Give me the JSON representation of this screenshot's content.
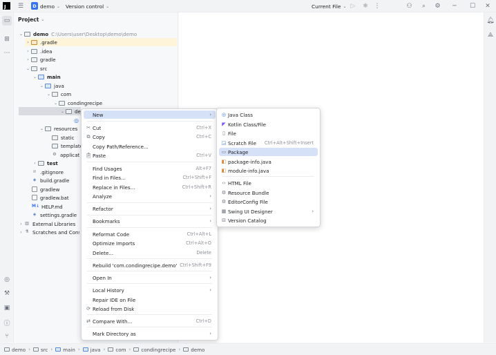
{
  "titlebar": {
    "project_badge": "D",
    "project_name": "demo",
    "vcs_label": "Version control",
    "run_config": "Current File"
  },
  "panel": {
    "title": "Project"
  },
  "tree": [
    {
      "label": "demo",
      "path": "C:\\Users\\user\\Desktop\\demo\\demo"
    },
    {
      "label": ".gradle"
    },
    {
      "label": ".idea"
    },
    {
      "label": "gradle"
    },
    {
      "label": "src"
    },
    {
      "label": "main"
    },
    {
      "label": "java"
    },
    {
      "label": "com"
    },
    {
      "label": "condingrecipe"
    },
    {
      "label": "demo"
    },
    {
      "label": "resources"
    },
    {
      "label": "static"
    },
    {
      "label": "templates"
    },
    {
      "label": "application.properties"
    },
    {
      "label": "test"
    },
    {
      "label": ".gitignore"
    },
    {
      "label": "build.gradle"
    },
    {
      "label": "gradlew"
    },
    {
      "label": "gradlew.bat"
    },
    {
      "label": "HELP.md"
    },
    {
      "label": "settings.gradle"
    },
    {
      "label": "External Libraries"
    },
    {
      "label": "Scratches and Consoles"
    }
  ],
  "context_menu": {
    "new": "New",
    "cut": "Cut",
    "cut_sc": "Ctrl+X",
    "copy": "Copy",
    "copy_sc": "Ctrl+C",
    "copy_path": "Copy Path/Reference...",
    "paste": "Paste",
    "paste_sc": "Ctrl+V",
    "find_usages": "Find Usages",
    "find_usages_sc": "Alt+F7",
    "find_in_files": "Find in Files...",
    "find_in_files_sc": "Ctrl+Shift+F",
    "replace_in_files": "Replace in Files...",
    "replace_in_files_sc": "Ctrl+Shift+R",
    "analyze": "Analyze",
    "refactor": "Refactor",
    "bookmarks": "Bookmarks",
    "reformat": "Reformat Code",
    "reformat_sc": "Ctrl+Alt+L",
    "optimize": "Optimize Imports",
    "optimize_sc": "Ctrl+Alt+O",
    "delete": "Delete...",
    "delete_sc": "Delete",
    "rebuild": "Rebuild 'com.condingrecipe.demo'",
    "rebuild_sc": "Ctrl+Shift+F9",
    "open_in": "Open In",
    "local_history": "Local History",
    "repair": "Repair IDE on File",
    "reload": "Reload from Disk",
    "compare": "Compare With...",
    "compare_sc": "Ctrl+D",
    "mark_dir": "Mark Directory as"
  },
  "submenu": {
    "java_class": "Java Class",
    "kotlin": "Kotlin Class/File",
    "file": "File",
    "scratch": "Scratch File",
    "scratch_sc": "Ctrl+Alt+Shift+Insert",
    "package": "Package",
    "package_info": "package-info.java",
    "module_info": "module-info.java",
    "html": "HTML File",
    "resource_bundle": "Resource Bundle",
    "editorconfig": "EditorConfig File",
    "swing": "Swing UI Designer",
    "version_catalog": "Version Catalog"
  },
  "statusbar": {
    "crumbs": [
      "demo",
      "src",
      "main",
      "java",
      "com",
      "condingrecipe",
      "demo"
    ]
  }
}
